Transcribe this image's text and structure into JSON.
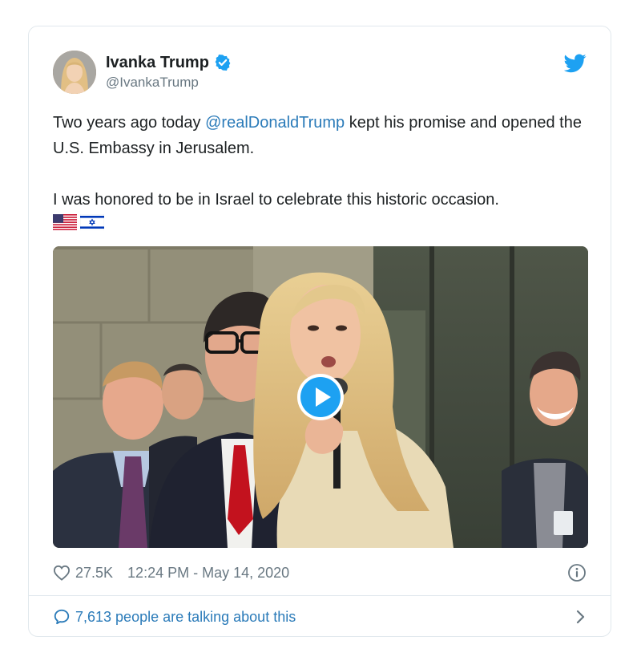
{
  "author": {
    "display_name": "Ivanka Trump",
    "handle": "@IvankaTrump",
    "verified": true,
    "avatar_icon": "avatar-photo"
  },
  "tweet": {
    "line1_before": "Two years ago today ",
    "line1_mention": "@realDonaldTrump",
    "line1_after": " kept his promise and opened the U.S. Embassy in Jerusalem.",
    "line2": "I was honored to be in Israel to celebrate this historic occasion.",
    "flags": [
      "us-flag-icon",
      "israel-flag-icon"
    ]
  },
  "media": {
    "type": "video",
    "play_icon": "play-icon"
  },
  "meta": {
    "likes": "27.5K",
    "timestamp": "12:24 PM - May 14, 2020"
  },
  "footer": {
    "label": "7,613 people are talking about this"
  },
  "colors": {
    "link": "#2b7bb9",
    "verified": "#1da1f2",
    "muted": "#697882",
    "text": "#1c2022",
    "border": "#e1e8ed"
  }
}
